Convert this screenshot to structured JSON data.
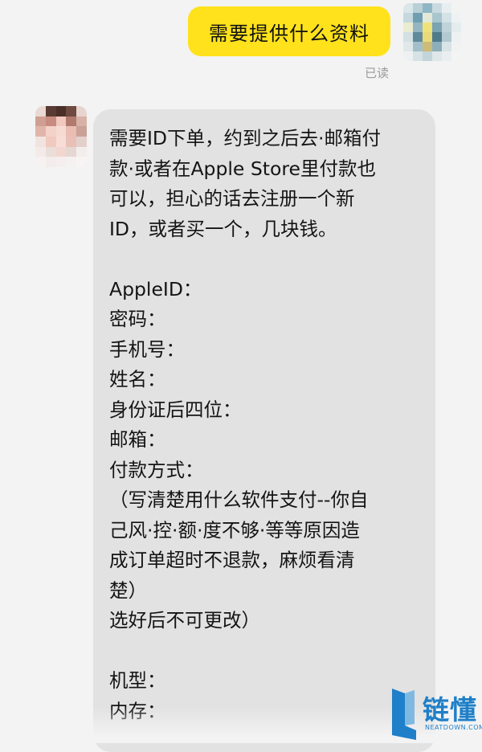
{
  "chat": {
    "outgoing": {
      "text": "需要提供什么资料",
      "status": "已读"
    },
    "incoming": {
      "lines": [
        "需要ID下单，约到之后去·邮箱付",
        "款·或者在Apple Store里付款也",
        "可以，担心的话去注册一个新",
        "ID，或者买一个，几块钱。",
        "",
        "AppleID：",
        "密码：",
        "手机号：",
        "姓名：",
        "身份证后四位：",
        "邮箱：",
        "付款方式：",
        "（写清楚用什么软件支付--你自",
        "己风·控·额·度不够·等等原因造",
        "成订单超时不退款，麻烦看清",
        "楚）",
        "选好后不可更改）",
        "",
        "机型：",
        "内存："
      ]
    }
  },
  "watermark": {
    "brand": "链懂",
    "domain": "NEATDOWN.COM"
  },
  "colors": {
    "background": "#f3f3f3",
    "outgoing_bubble": "#ffe21c",
    "incoming_bubble": "#e2e2e2",
    "read_status": "#9a9a9a",
    "watermark_blue": "#1f7fc8"
  },
  "avatars": {
    "me_pixels": [
      "#d9e6ea",
      "#b9cfd6",
      "#8fb6c4",
      "#c9dbe0",
      "#e8eef0",
      "#f2f4f4",
      "#c5d8dd",
      "#6f9eb0",
      "#e3e9d8",
      "#a9c6cf",
      "#d4e2e6",
      "#eef2f2",
      "#e9ecd0",
      "#93b6c2",
      "#f0e27a",
      "#7aa3b3",
      "#c0d3d9",
      "#e5ecee",
      "#d3e0e4",
      "#5f8a9b",
      "#e8d97a",
      "#4e7a8c",
      "#b3c9d0",
      "#edf1f2",
      "#e0e8ea",
      "#a2c0ca",
      "#cdbb7a",
      "#8daebb",
      "#d8e4e7",
      "#f1f3f3",
      "#eef1f2",
      "#d6e2e5",
      "#c3d5da",
      "#dfe7ea",
      "#eaeef0",
      "#f3f4f4"
    ],
    "them_pixels": [
      "#e9d8d3",
      "#5a3b33",
      "#4a2f29",
      "#6e4a40",
      "#e7d4ce",
      "#cf9f93",
      "#c88b7f",
      "#f0c8bd",
      "#b07a6e",
      "#d8b1a7",
      "#e2b5aa",
      "#f3d2c9",
      "#f6dbd3",
      "#e9bdb2",
      "#caa196",
      "#f1e4e0",
      "#f1c9bf",
      "#f7ddd6",
      "#e8c0b6",
      "#e3d0cb",
      "#f4ebe8",
      "#eaded9",
      "#f2d6cf",
      "#e6d7d3",
      "#f3eeec",
      "#f6f2f1",
      "#f2ecea",
      "#f4efee",
      "#f5f1f0",
      "#f7f4f3"
    ]
  }
}
